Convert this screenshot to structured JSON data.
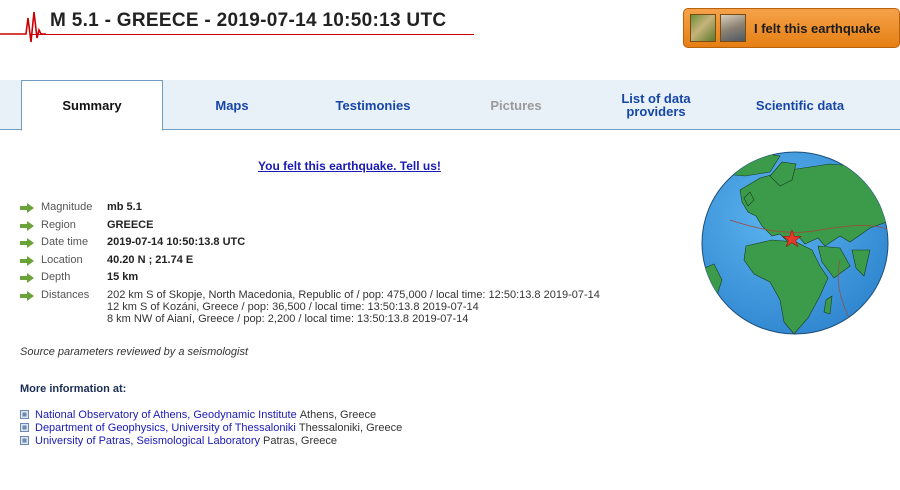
{
  "header": {
    "title": "M 5.1 - GREECE - 2019-07-14 10:50:13 UTC",
    "felt_button": "I felt this earthquake"
  },
  "tabs": [
    {
      "label": "Summary",
      "state": "active"
    },
    {
      "label": "Maps",
      "state": "enabled"
    },
    {
      "label": "Testimonies",
      "state": "enabled"
    },
    {
      "label": "Pictures",
      "state": "disabled"
    },
    {
      "label": "List of data providers",
      "state": "enabled"
    },
    {
      "label": "Scientific data",
      "state": "enabled"
    }
  ],
  "tell_us": "You felt this earthquake. Tell us!",
  "params": {
    "magnitude": {
      "label": "Magnitude",
      "value": "mb 5.1"
    },
    "region": {
      "label": "Region",
      "value": "GREECE"
    },
    "datetime": {
      "label": "Date time",
      "value": "2019-07-14 10:50:13.8 UTC"
    },
    "location": {
      "label": "Location",
      "value": "40.20 N ; 21.74 E"
    },
    "depth": {
      "label": "Depth",
      "value": "15 km"
    },
    "distances": {
      "label": "Distances",
      "lines": [
        "202 km S of Skopje, North Macedonia, Republic of / pop: 475,000 / local time: 12:50:13.8 2019-07-14",
        "12 km S of Kozáni, Greece / pop: 36,500 / local time: 13:50:13.8 2019-07-14",
        "8 km NW of Aianí, Greece / pop: 2,200 / local time: 13:50:13.8 2019-07-14"
      ]
    }
  },
  "reviewed": "Source parameters reviewed by a seismologist",
  "more_info": {
    "title": "More information at:",
    "links": [
      {
        "link": "National Observatory of Athens, Geodynamic Institute",
        "location": "Athens, Greece"
      },
      {
        "link": "Department of Geophysics, University of Thessaloniki",
        "location": "Thessaloniki, Greece"
      },
      {
        "link": "University of Patras, Seismological Laboratory",
        "location": "Patras, Greece"
      }
    ]
  },
  "colors": {
    "accent_link": "#1a1ab4",
    "tab_text": "#1646a6",
    "tab_border": "#6f9dc4",
    "button_orange": "#e57f14",
    "arrow_green": "#6aa23a",
    "epicenter_red": "#e53a2a",
    "ocean": "#3f9ce0",
    "land": "#3b9b4a"
  },
  "icons": {
    "header_graphic": "seismogram-icon",
    "param_bullet": "green-arrow-icon",
    "link_bullet": "square-bullet-icon",
    "globe": "globe-map-icon",
    "epicenter": "star-icon"
  }
}
